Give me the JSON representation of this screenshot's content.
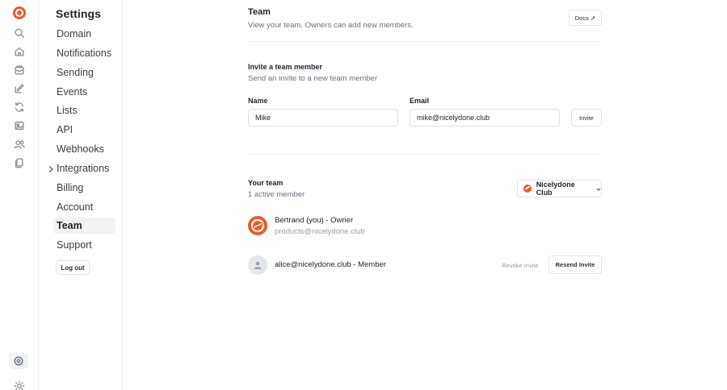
{
  "rail": {
    "icons": [
      "logo-icon",
      "search-icon",
      "home-icon",
      "inbox-icon",
      "compose-icon",
      "automation-icon",
      "template-icon",
      "contacts-icon",
      "files-icon",
      "settings-icon",
      "theme-toggle-icon"
    ]
  },
  "sidebar": {
    "title": "Settings",
    "items": [
      {
        "label": "Domain"
      },
      {
        "label": "Notifications"
      },
      {
        "label": "Sending"
      },
      {
        "label": "Events"
      },
      {
        "label": "Lists"
      },
      {
        "label": "API"
      },
      {
        "label": "Webhooks"
      },
      {
        "label": "Integrations"
      },
      {
        "label": "Billing"
      },
      {
        "label": "Account"
      },
      {
        "label": "Team"
      },
      {
        "label": "Support"
      }
    ],
    "active": "Team",
    "logout_label": "Log out"
  },
  "header": {
    "title": "Team",
    "subtitle": "View your team. Owners can add new members.",
    "docs_label": "Docs ↗"
  },
  "invite": {
    "title": "Invite a team member",
    "subtitle": "Send an invite to a new team member",
    "name_label": "Name",
    "name_value": "Mike",
    "email_label": "Email",
    "email_value": "mike@nicelydone.club",
    "invite_label": "Invite"
  },
  "team": {
    "title": "Your team",
    "count_text": "1 active member",
    "org_name": "Nicelydone Club",
    "members": [
      {
        "name": "Bertrand (you) - Owner",
        "email": "products@nicelydone.club"
      },
      {
        "name": "alice@nicelydone.club - Member"
      }
    ],
    "revoke_label": "Revoke Invite",
    "resend_label": "Resend Invite"
  },
  "colors": {
    "brand": "#ef5a24",
    "text": "#1f2328",
    "muted": "#6b7280",
    "border": "#e3e6ea"
  }
}
